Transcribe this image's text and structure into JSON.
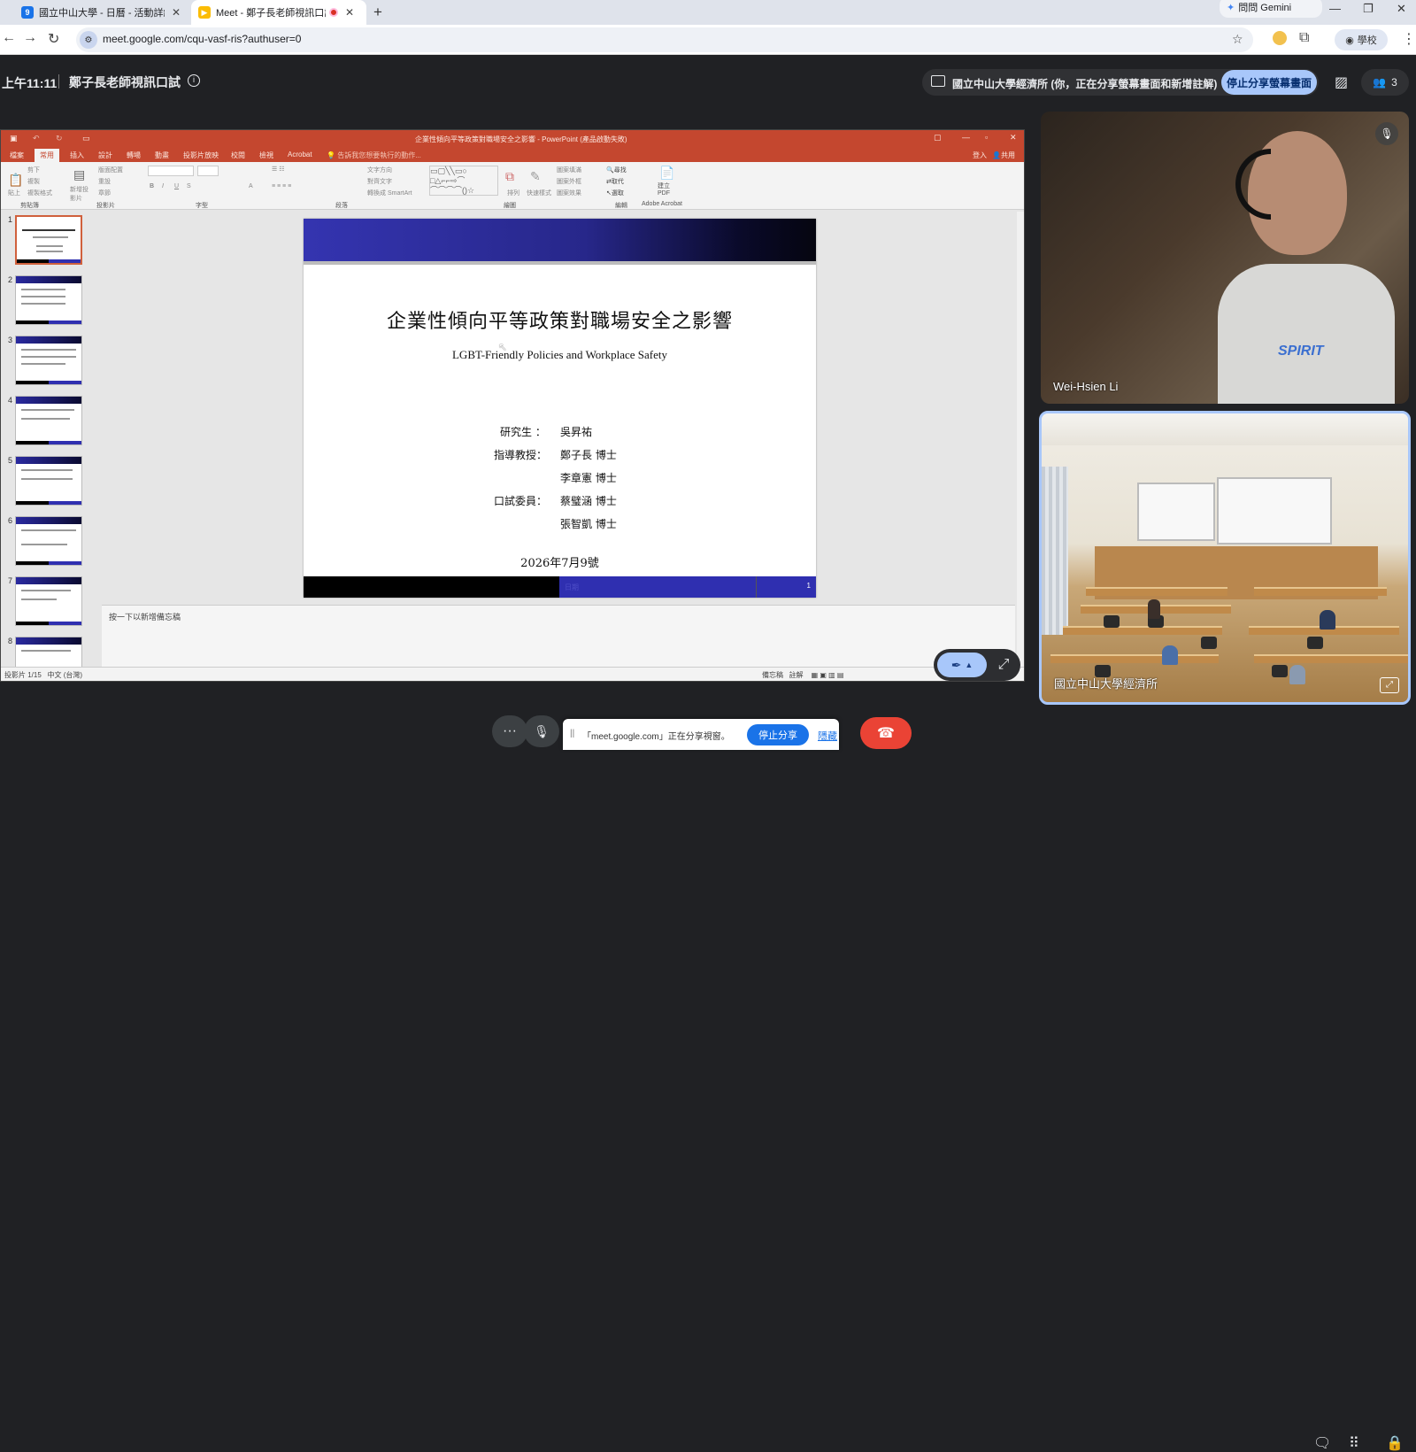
{
  "browser": {
    "tabs": [
      {
        "title": "國立中山大學 - 日曆 - 活動詳細",
        "icon": "calendar-icon"
      },
      {
        "title": "Meet - 鄭子長老師視訊口試",
        "icon": "meet-icon",
        "recording": true
      }
    ],
    "gemini_label": "問問 Gemini",
    "url": "meet.google.com/cqu-vasf-ris?authuser=0",
    "profile_label": "學校"
  },
  "meet": {
    "time": "上午11:11",
    "meeting_title": "鄭子長老師視訊口試",
    "share_status": "國立中山大學經濟所 (你，正在分享螢幕畫面和新增註解)",
    "stop_share_label": "停止分享螢幕畫面",
    "participant_count": "3",
    "participants": [
      {
        "name": "Wei-Hsien Li",
        "muted": true
      },
      {
        "name": "國立中山大學經濟所",
        "muted": false
      }
    ],
    "notice": {
      "text": "「meet.google.com」正在分享視窗。",
      "stop_label": "停止分享",
      "hide_label": "隱藏"
    }
  },
  "ppt": {
    "window_title": "企業性傾向平等政策對職場安全之影響 - PowerPoint (產品啟動失敗)",
    "tabs": [
      "檔案",
      "常用",
      "插入",
      "設計",
      "轉場",
      "動畫",
      "投影片放映",
      "校閱",
      "檢視",
      "Acrobat"
    ],
    "active_tab": "常用",
    "search_hint": "告訴我您想要執行的動作...",
    "signin": "登入",
    "share": "共用",
    "groups": [
      "剪貼簿",
      "投影片",
      "字型",
      "段落",
      "繪圖",
      "編輯",
      "Adobe Acrobat"
    ],
    "ribbon_items": [
      "剪下",
      "複製",
      "複製格式",
      "貼上",
      "新增投影片",
      "版面配置",
      "重設",
      "章節",
      "文字方向",
      "對齊文字",
      "轉換成 SmartArt",
      "排列",
      "快速樣式",
      "圖案填滿",
      "圖案外框",
      "圖案效果",
      "尋找",
      "取代",
      "選取",
      "建立 PDF"
    ],
    "slide_numbers": [
      "1",
      "2",
      "3",
      "4",
      "5",
      "6",
      "7",
      "8"
    ],
    "notes_placeholder": "按一下以新增備忘稿",
    "status_left": "投影片 1/15",
    "status_lang": "中文 (台灣)",
    "status_notes": "備忘稿",
    "status_comments": "註解"
  },
  "slide": {
    "title": "企業性傾向平等政策對職場安全之影響",
    "subtitle": "LGBT-Friendly Policies and Workplace Safety",
    "credits": [
      {
        "role": "研究生 ：",
        "name": "吳昇祐"
      },
      {
        "role": "指導教授：",
        "name": "鄭子長 博士"
      },
      {
        "role": "",
        "name": "李章憲 博士"
      },
      {
        "role": "口試委員：",
        "name": "蔡璧涵 博士"
      },
      {
        "role": "",
        "name": "張智凱 博士"
      }
    ],
    "date": "2026年7月9號",
    "footer_label": "日期",
    "page_number": "1"
  }
}
